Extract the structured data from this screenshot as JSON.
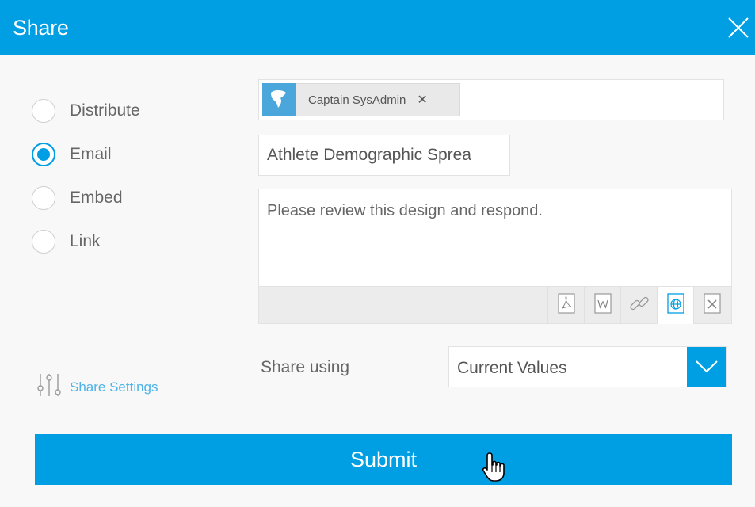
{
  "dialog": {
    "title": "Share"
  },
  "share_options": [
    {
      "label": "Distribute",
      "selected": false
    },
    {
      "label": "Email",
      "selected": true
    },
    {
      "label": "Embed",
      "selected": false
    },
    {
      "label": "Link",
      "selected": false
    }
  ],
  "share_settings_label": "Share Settings",
  "recipients": [
    {
      "name": "Captain SysAdmin",
      "remove_glyph": "✕"
    }
  ],
  "subject_value": "Athlete Demographic Sprea",
  "message_value": "Please review this design and respond.",
  "formats": [
    {
      "icon": "pdf-icon",
      "active": false
    },
    {
      "icon": "word-icon",
      "active": false
    },
    {
      "icon": "link-icon",
      "active": false
    },
    {
      "icon": "web-icon",
      "active": true
    },
    {
      "icon": "excel-icon",
      "active": false
    }
  ],
  "share_using": {
    "label": "Share using",
    "value": "Current Values"
  },
  "submit_label": "Submit",
  "colors": {
    "accent": "#009fe3",
    "avatar": "#4aa6db",
    "link": "#4fb3e8"
  }
}
